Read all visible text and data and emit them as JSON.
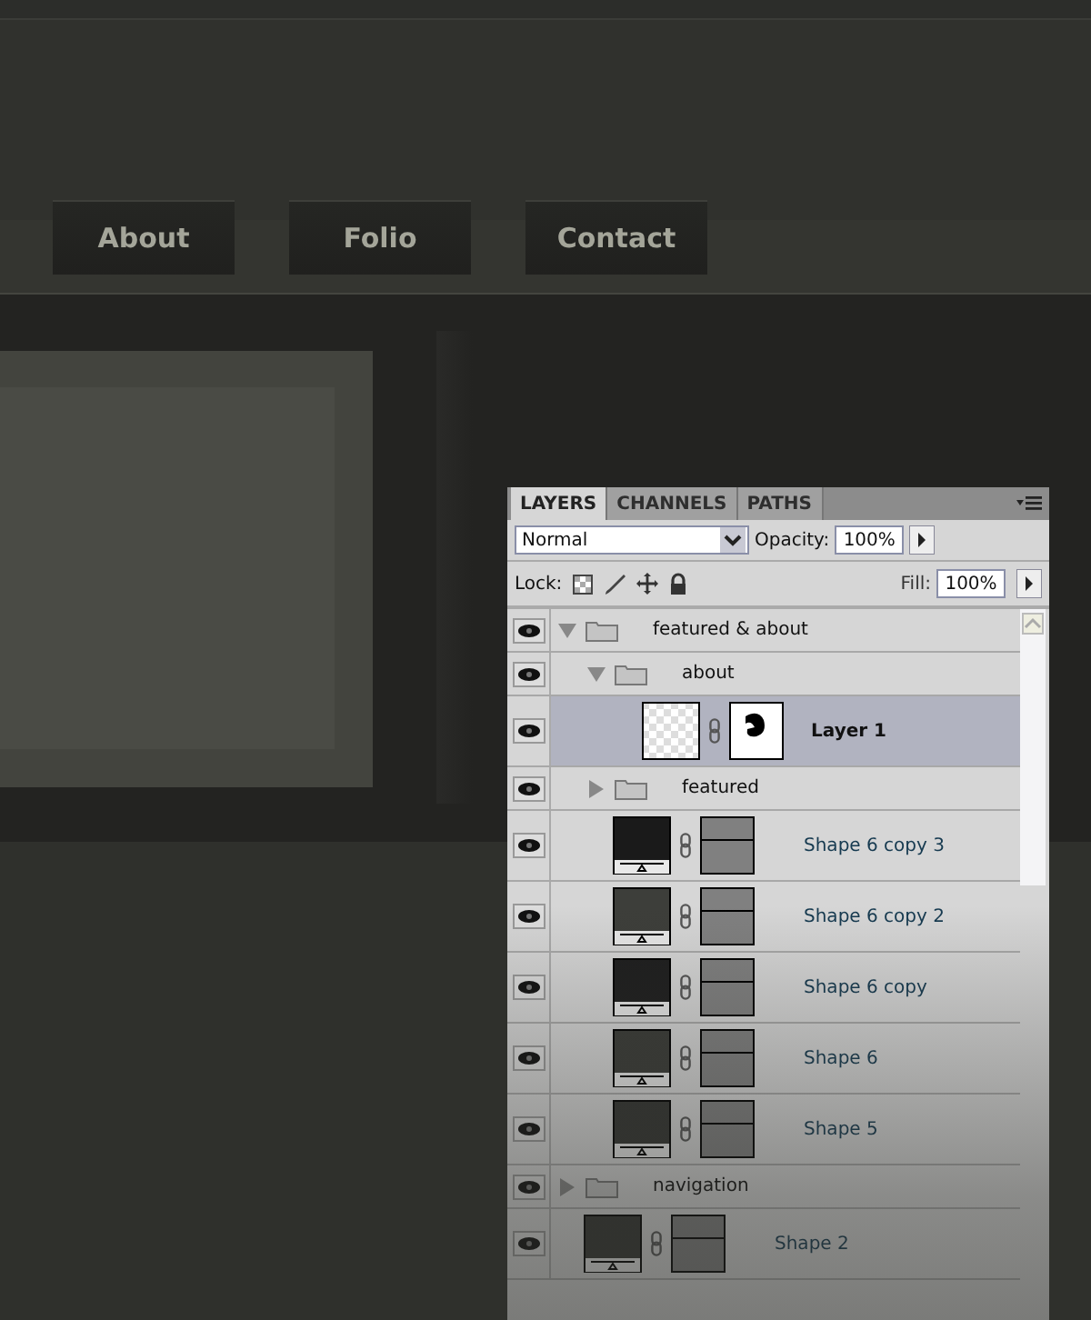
{
  "nav": [
    {
      "label": "About"
    },
    {
      "label": "Folio"
    },
    {
      "label": "Contact"
    }
  ],
  "layers_panel": {
    "tabs": [
      {
        "label": "LAYERS",
        "selected": true
      },
      {
        "label": "CHANNELS",
        "selected": false
      },
      {
        "label": "PATHS",
        "selected": false
      }
    ],
    "blend_mode": "Normal",
    "opacity_label": "Opacity:",
    "opacity": "100%",
    "lock_label": "Lock:",
    "fill_label": "Fill:",
    "fill": "100%",
    "layers": [
      {
        "kind": "group",
        "name": "featured & about",
        "visible": true,
        "expanded": true,
        "selected": false,
        "children": [
          {
            "kind": "group",
            "name": "about",
            "visible": true,
            "expanded": true,
            "selected": false,
            "children": [
              {
                "kind": "masked",
                "name": "Layer 1",
                "visible": true,
                "selected": true
              }
            ]
          },
          {
            "kind": "group",
            "name": "featured",
            "visible": true,
            "expanded": false,
            "selected": false
          },
          {
            "kind": "shape",
            "name": "Shape 6 copy 3",
            "visible": true,
            "selected": false,
            "color": "#1a1a1a"
          },
          {
            "kind": "shape",
            "name": "Shape 6 copy 2",
            "visible": true,
            "selected": false,
            "color": "#3d3e3a"
          },
          {
            "kind": "shape",
            "name": "Shape 6 copy",
            "visible": true,
            "selected": false,
            "color": "#1e1e1e"
          },
          {
            "kind": "shape",
            "name": "Shape 6",
            "visible": true,
            "selected": false,
            "color": "#3a3b37"
          },
          {
            "kind": "shape",
            "name": "Shape 5",
            "visible": true,
            "selected": false,
            "color": "#333431"
          }
        ]
      },
      {
        "kind": "group",
        "name": "navigation",
        "visible": true,
        "expanded": false,
        "selected": false
      },
      {
        "kind": "shape",
        "name": "Shape 2",
        "visible": true,
        "selected": false,
        "color": "#333431"
      }
    ]
  }
}
